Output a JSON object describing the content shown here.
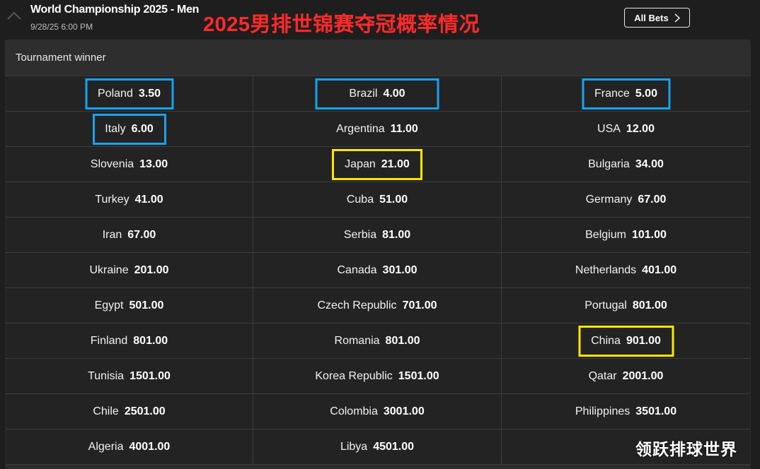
{
  "header": {
    "event_title": "World Championship 2025 - Men",
    "event_date": "9/28/25 6:00 PM",
    "overlay_title": "2025男排世锦赛夺冠概率情况",
    "all_bets_label": "All Bets",
    "collapse_icon": "chevron-up-icon",
    "all_bets_icon": "chevron-right-icon"
  },
  "market": {
    "title": "Tournament winner"
  },
  "highlight_colors": {
    "blue": "#17a2f0",
    "yellow": "#ffe600"
  },
  "selections": [
    {
      "team": "Poland",
      "odds": "3.50",
      "highlight": "blue"
    },
    {
      "team": "Brazil",
      "odds": "4.00",
      "highlight": "blue"
    },
    {
      "team": "France",
      "odds": "5.00",
      "highlight": "blue"
    },
    {
      "team": "Italy",
      "odds": "6.00",
      "highlight": "blue"
    },
    {
      "team": "Argentina",
      "odds": "11.00"
    },
    {
      "team": "USA",
      "odds": "12.00"
    },
    {
      "team": "Slovenia",
      "odds": "13.00"
    },
    {
      "team": "Japan",
      "odds": "21.00",
      "highlight": "yellow"
    },
    {
      "team": "Bulgaria",
      "odds": "34.00"
    },
    {
      "team": "Turkey",
      "odds": "41.00"
    },
    {
      "team": "Cuba",
      "odds": "51.00"
    },
    {
      "team": "Germany",
      "odds": "67.00"
    },
    {
      "team": "Iran",
      "odds": "67.00"
    },
    {
      "team": "Serbia",
      "odds": "81.00"
    },
    {
      "team": "Belgium",
      "odds": "101.00"
    },
    {
      "team": "Ukraine",
      "odds": "201.00"
    },
    {
      "team": "Canada",
      "odds": "301.00"
    },
    {
      "team": "Netherlands",
      "odds": "401.00"
    },
    {
      "team": "Egypt",
      "odds": "501.00"
    },
    {
      "team": "Czech Republic",
      "odds": "701.00"
    },
    {
      "team": "Portugal",
      "odds": "801.00"
    },
    {
      "team": "Finland",
      "odds": "801.00"
    },
    {
      "team": "Romania",
      "odds": "801.00"
    },
    {
      "team": "China",
      "odds": "901.00",
      "highlight": "yellow"
    },
    {
      "team": "Tunisia",
      "odds": "1501.00"
    },
    {
      "team": "Korea Republic",
      "odds": "1501.00"
    },
    {
      "team": "Qatar",
      "odds": "2001.00"
    },
    {
      "team": "Chile",
      "odds": "2501.00"
    },
    {
      "team": "Colombia",
      "odds": "3001.00"
    },
    {
      "team": "Philippines",
      "odds": "3501.00"
    },
    {
      "team": "Algeria",
      "odds": "4001.00"
    },
    {
      "team": "Libya",
      "odds": "4501.00"
    }
  ],
  "watermark": "领跃排球世界"
}
